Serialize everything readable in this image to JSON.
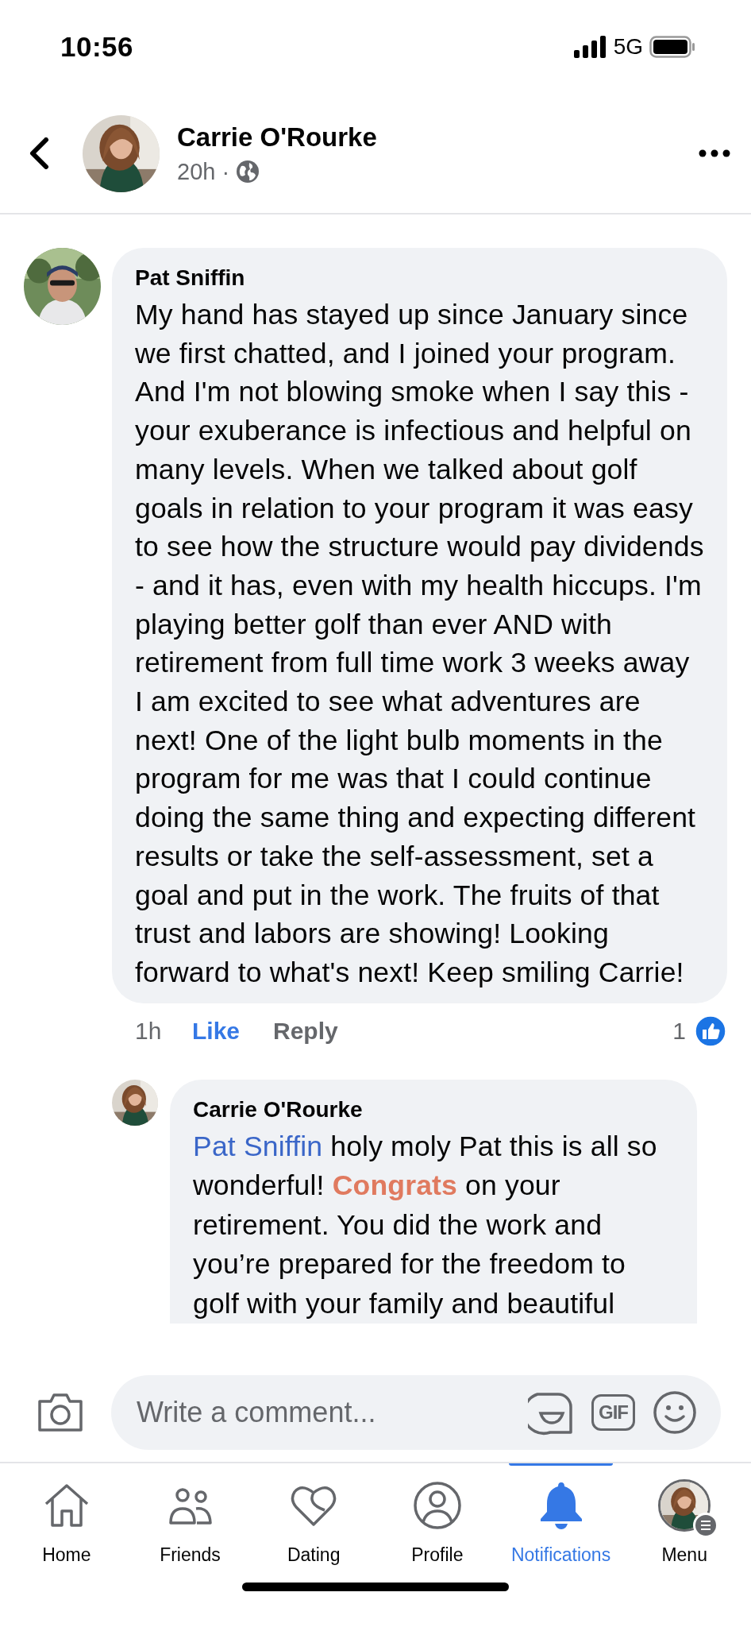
{
  "status_bar": {
    "time": "10:56",
    "network": "5G"
  },
  "header": {
    "author": "Carrie O'Rourke",
    "time": "20h",
    "separator": "·"
  },
  "comment": {
    "author": "Pat Sniffin",
    "text": "My hand has stayed up since January since we first chatted, and I joined your program. And I'm not blowing smoke when I say this - your exuberance is infectious and helpful on many levels. When we talked about golf goals in relation to your program it was easy to see how the structure would pay dividends - and it has, even with my health hiccups. I'm playing better golf than ever AND with retirement from full time work 3 weeks away I am excited to see what adventures are next! One of the light bulb moments in the program for me was that I could continue doing the same thing and expecting different results or take the self-assessment, set a goal and put in the work. The fruits of that trust and labors are showing! Looking forward to what's next! Keep smiling Carrie!",
    "time": "1h",
    "like_label": "Like",
    "liked": true,
    "reply_label": "Reply",
    "reaction_count": "1"
  },
  "reply": {
    "author": "Carrie O'Rourke",
    "mention": "Pat Sniffin",
    "text": "holy moly Pat this is all so wonderful! **Congrats** on your retirement. You did the work and you’re prepared for the freedom to golf with your family and beautiful"
  },
  "composer": {
    "placeholder": "Write a comment...",
    "gif_label": "GIF"
  },
  "nav": [
    {
      "kind": "home",
      "label": "Home",
      "selected": false
    },
    {
      "kind": "friends",
      "label": "Friends",
      "selected": false
    },
    {
      "kind": "dating",
      "label": "Dating",
      "selected": false
    },
    {
      "kind": "profile",
      "label": "Profile",
      "selected": false
    },
    {
      "kind": "notifications",
      "label": "Notifications",
      "selected": true
    },
    {
      "kind": "menu",
      "label": "Menu",
      "selected": false
    }
  ]
}
